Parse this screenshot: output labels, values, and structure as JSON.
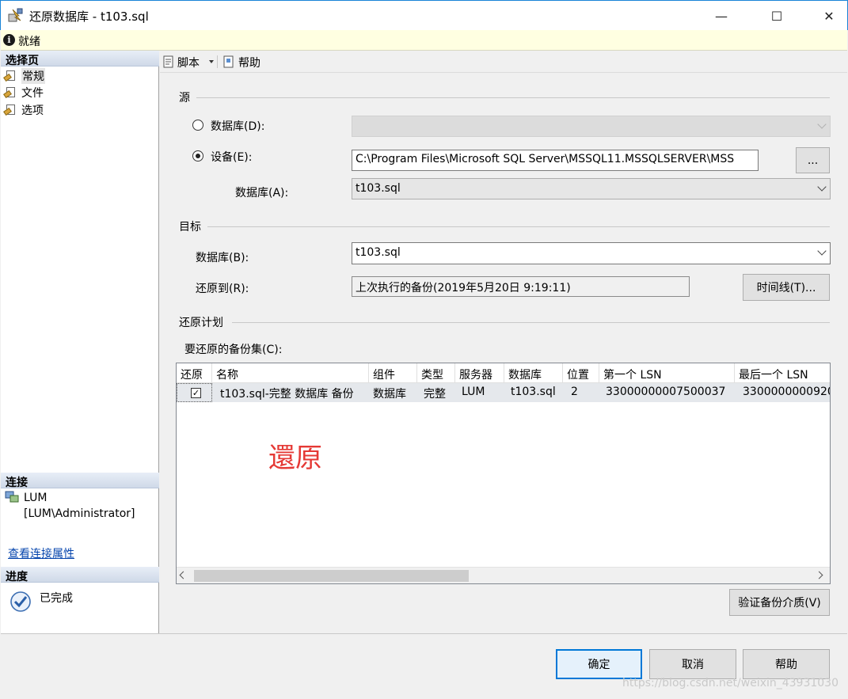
{
  "window": {
    "title": "还原数据库 - t103.sql",
    "minimize": "—",
    "maximize": "☐",
    "close": "✕"
  },
  "status": {
    "text": "就绪"
  },
  "left_pane": {
    "select_page_header": "选择页",
    "pages": [
      {
        "label": "常规"
      },
      {
        "label": "文件"
      },
      {
        "label": "选项"
      }
    ],
    "connection_header": "连接",
    "server": "LUM",
    "login": "[LUM\\Administrator]",
    "view_connection_link": "查看连接属性",
    "progress_header": "进度",
    "progress_status": "已完成"
  },
  "toolbar": {
    "script_label": "脚本",
    "help_label": "帮助"
  },
  "source": {
    "group_title": "源",
    "database_option": "数据库(D):",
    "device_option": "设备(E):",
    "device_path": "C:\\Program Files\\Microsoft SQL Server\\MSSQL11.MSSQLSERVER\\MSS",
    "browse_label": "...",
    "database_label": "数据库(A):",
    "database_value": "t103.sql",
    "selected_option": "device"
  },
  "target": {
    "group_title": "目标",
    "database_label": "数据库(B):",
    "database_value": "t103.sql",
    "restore_to_label": "还原到(R):",
    "restore_to_value": "上次执行的备份(2019年5月20日 9:19:11)",
    "timeline_button": "时间线(T)..."
  },
  "plan": {
    "group_title": "还原计划",
    "backup_sets_label": "要还原的备份集(C):",
    "columns": [
      "还原",
      "名称",
      "组件",
      "类型",
      "服务器",
      "数据库",
      "位置",
      "第一个 LSN",
      "最后一个 LSN"
    ],
    "rows": [
      {
        "restore": true,
        "name": "t103.sql-完整 数据库 备份",
        "component": "数据库",
        "type": "完整",
        "server": "LUM",
        "database": "t103.sql",
        "position": "2",
        "first_lsn": "33000000007500037",
        "last_lsn": "3300000000920"
      }
    ],
    "annotation": "還原",
    "verify_button": "验证备份介质(V)"
  },
  "buttons": {
    "ok": "确定",
    "cancel": "取消",
    "help": "帮助"
  },
  "watermark": "https://blog.csdn.net/weixin_43931030",
  "colors": {
    "accent": "#0078d7",
    "annotation": "#e53935",
    "info_bar": "#ffffe1"
  }
}
